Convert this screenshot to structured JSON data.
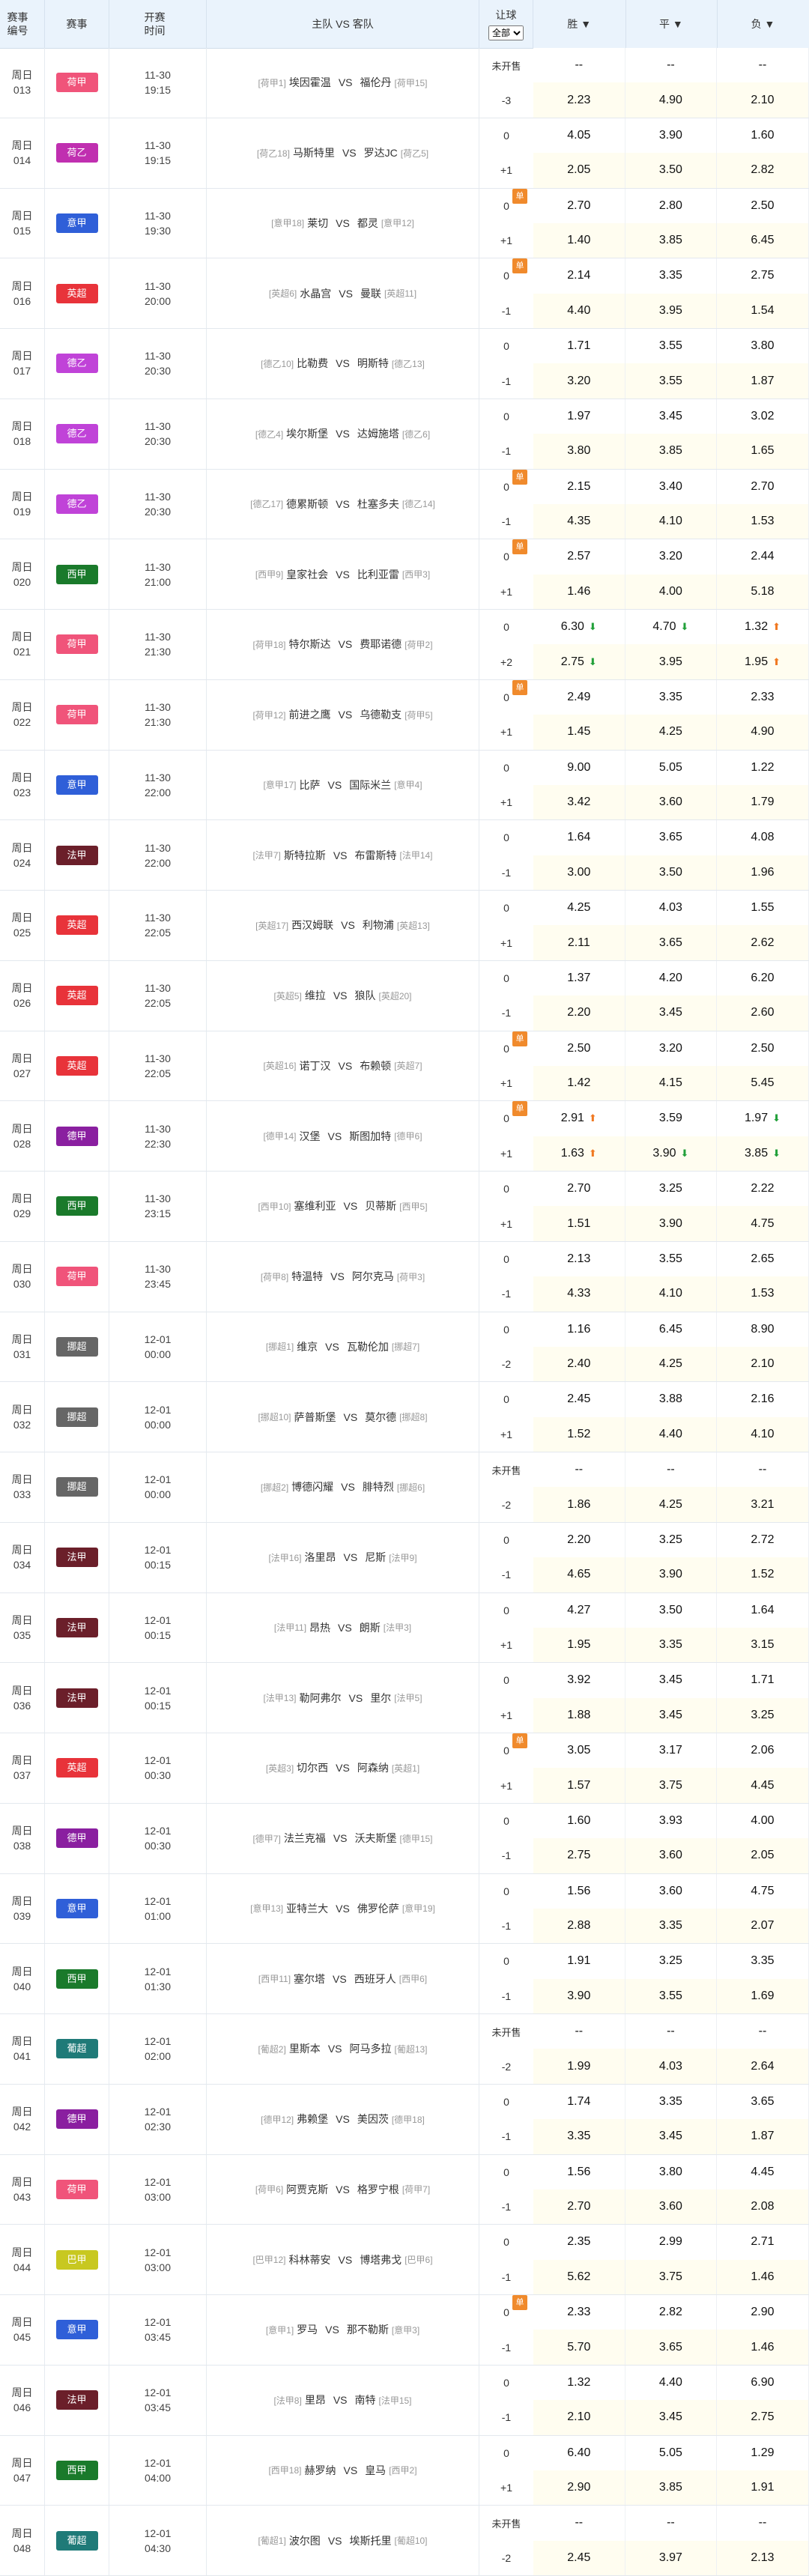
{
  "header": {
    "no": "赛事编号",
    "league": "赛事",
    "time": "开赛时间",
    "match": "主队 VS 客队",
    "rq": "让球",
    "filter": "全部",
    "win": "胜 ▼",
    "draw": "平 ▼",
    "lose": "负 ▼"
  },
  "colors": {
    "荷甲": "#f0547a",
    "荷乙": "#c02fb0",
    "意甲": "#2f5fd8",
    "英超": "#e8333a",
    "德乙": "#c043d8",
    "西甲": "#1a7a2b",
    "法甲": "#6b1f2a",
    "德甲": "#8a1fa0",
    "挪超": "#666666",
    "葡超": "#1f7a78",
    "巴甲": "#c8c820"
  },
  "rows": [
    {
      "no1": "周日",
      "no2": "013",
      "lg": "荷甲",
      "d": "11-30",
      "t": "19:15",
      "hr": "[荷甲1]",
      "h": "埃因霍温",
      "a": "福伦丹",
      "ar": "[荷甲15]",
      "r1": "未开售",
      "r2": "-3",
      "dan": false,
      "o1": [
        "--",
        "--",
        "--"
      ],
      "o2": [
        "2.23",
        "4.90",
        "2.10"
      ]
    },
    {
      "no1": "周日",
      "no2": "014",
      "lg": "荷乙",
      "d": "11-30",
      "t": "19:15",
      "hr": "[荷乙18]",
      "h": "马斯特里",
      "a": "罗达JC",
      "ar": "[荷乙5]",
      "r1": "0",
      "r2": "+1",
      "dan": false,
      "o1": [
        "4.05",
        "3.90",
        "1.60"
      ],
      "o2": [
        "2.05",
        "3.50",
        "2.82"
      ]
    },
    {
      "no1": "周日",
      "no2": "015",
      "lg": "意甲",
      "d": "11-30",
      "t": "19:30",
      "hr": "[意甲18]",
      "h": "莱切",
      "a": "都灵",
      "ar": "[意甲12]",
      "r1": "0",
      "r2": "+1",
      "dan": true,
      "o1": [
        "2.70",
        "2.80",
        "2.50"
      ],
      "o2": [
        "1.40",
        "3.85",
        "6.45"
      ]
    },
    {
      "no1": "周日",
      "no2": "016",
      "lg": "英超",
      "d": "11-30",
      "t": "20:00",
      "hr": "[英超6]",
      "h": "水晶宫",
      "a": "曼联",
      "ar": "[英超11]",
      "r1": "0",
      "r2": "-1",
      "dan": true,
      "o1": [
        "2.14",
        "3.35",
        "2.75"
      ],
      "o2": [
        "4.40",
        "3.95",
        "1.54"
      ]
    },
    {
      "no1": "周日",
      "no2": "017",
      "lg": "德乙",
      "d": "11-30",
      "t": "20:30",
      "hr": "[德乙10]",
      "h": "比勒费",
      "a": "明斯特",
      "ar": "[德乙13]",
      "r1": "0",
      "r2": "-1",
      "dan": false,
      "o1": [
        "1.71",
        "3.55",
        "3.80"
      ],
      "o2": [
        "3.20",
        "3.55",
        "1.87"
      ]
    },
    {
      "no1": "周日",
      "no2": "018",
      "lg": "德乙",
      "d": "11-30",
      "t": "20:30",
      "hr": "[德乙4]",
      "h": "埃尔斯堡",
      "a": "达姆施塔",
      "ar": "[德乙6]",
      "r1": "0",
      "r2": "-1",
      "dan": false,
      "o1": [
        "1.97",
        "3.45",
        "3.02"
      ],
      "o2": [
        "3.80",
        "3.85",
        "1.65"
      ]
    },
    {
      "no1": "周日",
      "no2": "019",
      "lg": "德乙",
      "d": "11-30",
      "t": "20:30",
      "hr": "[德乙17]",
      "h": "德累斯顿",
      "a": "杜塞多夫",
      "ar": "[德乙14]",
      "r1": "0",
      "r2": "-1",
      "dan": true,
      "o1": [
        "2.15",
        "3.40",
        "2.70"
      ],
      "o2": [
        "4.35",
        "4.10",
        "1.53"
      ]
    },
    {
      "no1": "周日",
      "no2": "020",
      "lg": "西甲",
      "d": "11-30",
      "t": "21:00",
      "hr": "[西甲9]",
      "h": "皇家社会",
      "a": "比利亚雷",
      "ar": "[西甲3]",
      "r1": "0",
      "r2": "+1",
      "dan": true,
      "o1": [
        "2.57",
        "3.20",
        "2.44"
      ],
      "o2": [
        "1.46",
        "4.00",
        "5.18"
      ]
    },
    {
      "no1": "周日",
      "no2": "021",
      "lg": "荷甲",
      "d": "11-30",
      "t": "21:30",
      "hr": "[荷甲18]",
      "h": "特尔斯达",
      "a": "费耶诺德",
      "ar": "[荷甲2]",
      "r1": "0",
      "r2": "+2",
      "dan": false,
      "o1": [
        "6.30",
        "4.70",
        "1.32"
      ],
      "o2": [
        "2.75",
        "3.95",
        "1.95"
      ],
      "a1": [
        "down",
        "down",
        "up"
      ],
      "a2": [
        "down",
        "",
        "up"
      ]
    },
    {
      "no1": "周日",
      "no2": "022",
      "lg": "荷甲",
      "d": "11-30",
      "t": "21:30",
      "hr": "[荷甲12]",
      "h": "前进之鹰",
      "a": "乌德勒支",
      "ar": "[荷甲5]",
      "r1": "0",
      "r2": "+1",
      "dan": true,
      "o1": [
        "2.49",
        "3.35",
        "2.33"
      ],
      "o2": [
        "1.45",
        "4.25",
        "4.90"
      ]
    },
    {
      "no1": "周日",
      "no2": "023",
      "lg": "意甲",
      "d": "11-30",
      "t": "22:00",
      "hr": "[意甲17]",
      "h": "比萨",
      "a": "国际米兰",
      "ar": "[意甲4]",
      "r1": "0",
      "r2": "+1",
      "dan": false,
      "o1": [
        "9.00",
        "5.05",
        "1.22"
      ],
      "o2": [
        "3.42",
        "3.60",
        "1.79"
      ]
    },
    {
      "no1": "周日",
      "no2": "024",
      "lg": "法甲",
      "d": "11-30",
      "t": "22:00",
      "hr": "[法甲7]",
      "h": "斯特拉斯",
      "a": "布雷斯特",
      "ar": "[法甲14]",
      "r1": "0",
      "r2": "-1",
      "dan": false,
      "o1": [
        "1.64",
        "3.65",
        "4.08"
      ],
      "o2": [
        "3.00",
        "3.50",
        "1.96"
      ]
    },
    {
      "no1": "周日",
      "no2": "025",
      "lg": "英超",
      "d": "11-30",
      "t": "22:05",
      "hr": "[英超17]",
      "h": "西汉姆联",
      "a": "利物浦",
      "ar": "[英超13]",
      "r1": "0",
      "r2": "+1",
      "dan": false,
      "o1": [
        "4.25",
        "4.03",
        "1.55"
      ],
      "o2": [
        "2.11",
        "3.65",
        "2.62"
      ]
    },
    {
      "no1": "周日",
      "no2": "026",
      "lg": "英超",
      "d": "11-30",
      "t": "22:05",
      "hr": "[英超5]",
      "h": "维拉",
      "a": "狼队",
      "ar": "[英超20]",
      "r1": "0",
      "r2": "-1",
      "dan": false,
      "o1": [
        "1.37",
        "4.20",
        "6.20"
      ],
      "o2": [
        "2.20",
        "3.45",
        "2.60"
      ]
    },
    {
      "no1": "周日",
      "no2": "027",
      "lg": "英超",
      "d": "11-30",
      "t": "22:05",
      "hr": "[英超16]",
      "h": "诺丁汉",
      "a": "布赖顿",
      "ar": "[英超7]",
      "r1": "0",
      "r2": "+1",
      "dan": true,
      "o1": [
        "2.50",
        "3.20",
        "2.50"
      ],
      "o2": [
        "1.42",
        "4.15",
        "5.45"
      ]
    },
    {
      "no1": "周日",
      "no2": "028",
      "lg": "德甲",
      "d": "11-30",
      "t": "22:30",
      "hr": "[德甲14]",
      "h": "汉堡",
      "a": "斯图加特",
      "ar": "[德甲6]",
      "r1": "0",
      "r2": "+1",
      "dan": true,
      "o1": [
        "2.91",
        "3.59",
        "1.97"
      ],
      "o2": [
        "1.63",
        "3.90",
        "3.85"
      ],
      "a1": [
        "up",
        "",
        "down"
      ],
      "a2": [
        "up",
        "down",
        "down"
      ]
    },
    {
      "no1": "周日",
      "no2": "029",
      "lg": "西甲",
      "d": "11-30",
      "t": "23:15",
      "hr": "[西甲10]",
      "h": "塞维利亚",
      "a": "贝蒂斯",
      "ar": "[西甲5]",
      "r1": "0",
      "r2": "+1",
      "dan": false,
      "o1": [
        "2.70",
        "3.25",
        "2.22"
      ],
      "o2": [
        "1.51",
        "3.90",
        "4.75"
      ]
    },
    {
      "no1": "周日",
      "no2": "030",
      "lg": "荷甲",
      "d": "11-30",
      "t": "23:45",
      "hr": "[荷甲8]",
      "h": "特温特",
      "a": "阿尔克马",
      "ar": "[荷甲3]",
      "r1": "0",
      "r2": "-1",
      "dan": false,
      "o1": [
        "2.13",
        "3.55",
        "2.65"
      ],
      "o2": [
        "4.33",
        "4.10",
        "1.53"
      ]
    },
    {
      "no1": "周日",
      "no2": "031",
      "lg": "挪超",
      "d": "12-01",
      "t": "00:00",
      "hr": "[挪超1]",
      "h": "维京",
      "a": "瓦勒伦加",
      "ar": "[挪超7]",
      "r1": "0",
      "r2": "-2",
      "dan": false,
      "o1": [
        "1.16",
        "6.45",
        "8.90"
      ],
      "o2": [
        "2.40",
        "4.25",
        "2.10"
      ]
    },
    {
      "no1": "周日",
      "no2": "032",
      "lg": "挪超",
      "d": "12-01",
      "t": "00:00",
      "hr": "[挪超10]",
      "h": "萨普斯堡",
      "a": "莫尔德",
      "ar": "[挪超8]",
      "r1": "0",
      "r2": "+1",
      "dan": false,
      "o1": [
        "2.45",
        "3.88",
        "2.16"
      ],
      "o2": [
        "1.52",
        "4.40",
        "4.10"
      ]
    },
    {
      "no1": "周日",
      "no2": "033",
      "lg": "挪超",
      "d": "12-01",
      "t": "00:00",
      "hr": "[挪超2]",
      "h": "博德闪耀",
      "a": "腓特烈",
      "ar": "[挪超6]",
      "r1": "未开售",
      "r2": "-2",
      "dan": false,
      "o1": [
        "--",
        "--",
        "--"
      ],
      "o2": [
        "1.86",
        "4.25",
        "3.21"
      ]
    },
    {
      "no1": "周日",
      "no2": "034",
      "lg": "法甲",
      "d": "12-01",
      "t": "00:15",
      "hr": "[法甲16]",
      "h": "洛里昂",
      "a": "尼斯",
      "ar": "[法甲9]",
      "r1": "0",
      "r2": "-1",
      "dan": false,
      "o1": [
        "2.20",
        "3.25",
        "2.72"
      ],
      "o2": [
        "4.65",
        "3.90",
        "1.52"
      ]
    },
    {
      "no1": "周日",
      "no2": "035",
      "lg": "法甲",
      "d": "12-01",
      "t": "00:15",
      "hr": "[法甲11]",
      "h": "昂热",
      "a": "朗斯",
      "ar": "[法甲3]",
      "r1": "0",
      "r2": "+1",
      "dan": false,
      "o1": [
        "4.27",
        "3.50",
        "1.64"
      ],
      "o2": [
        "1.95",
        "3.35",
        "3.15"
      ]
    },
    {
      "no1": "周日",
      "no2": "036",
      "lg": "法甲",
      "d": "12-01",
      "t": "00:15",
      "hr": "[法甲13]",
      "h": "勒阿弗尔",
      "a": "里尔",
      "ar": "[法甲5]",
      "r1": "0",
      "r2": "+1",
      "dan": false,
      "o1": [
        "3.92",
        "3.45",
        "1.71"
      ],
      "o2": [
        "1.88",
        "3.45",
        "3.25"
      ]
    },
    {
      "no1": "周日",
      "no2": "037",
      "lg": "英超",
      "d": "12-01",
      "t": "00:30",
      "hr": "[英超3]",
      "h": "切尔西",
      "a": "阿森纳",
      "ar": "[英超1]",
      "r1": "0",
      "r2": "+1",
      "dan": true,
      "o1": [
        "3.05",
        "3.17",
        "2.06"
      ],
      "o2": [
        "1.57",
        "3.75",
        "4.45"
      ]
    },
    {
      "no1": "周日",
      "no2": "038",
      "lg": "德甲",
      "d": "12-01",
      "t": "00:30",
      "hr": "[德甲7]",
      "h": "法兰克福",
      "a": "沃夫斯堡",
      "ar": "[德甲15]",
      "r1": "0",
      "r2": "-1",
      "dan": false,
      "o1": [
        "1.60",
        "3.93",
        "4.00"
      ],
      "o2": [
        "2.75",
        "3.60",
        "2.05"
      ]
    },
    {
      "no1": "周日",
      "no2": "039",
      "lg": "意甲",
      "d": "12-01",
      "t": "01:00",
      "hr": "[意甲13]",
      "h": "亚特兰大",
      "a": "佛罗伦萨",
      "ar": "[意甲19]",
      "r1": "0",
      "r2": "-1",
      "dan": false,
      "o1": [
        "1.56",
        "3.60",
        "4.75"
      ],
      "o2": [
        "2.88",
        "3.35",
        "2.07"
      ]
    },
    {
      "no1": "周日",
      "no2": "040",
      "lg": "西甲",
      "d": "12-01",
      "t": "01:30",
      "hr": "[西甲11]",
      "h": "塞尔塔",
      "a": "西班牙人",
      "ar": "[西甲6]",
      "r1": "0",
      "r2": "-1",
      "dan": false,
      "o1": [
        "1.91",
        "3.25",
        "3.35"
      ],
      "o2": [
        "3.90",
        "3.55",
        "1.69"
      ]
    },
    {
      "no1": "周日",
      "no2": "041",
      "lg": "葡超",
      "d": "12-01",
      "t": "02:00",
      "hr": "[葡超2]",
      "h": "里斯本",
      "a": "阿马多拉",
      "ar": "[葡超13]",
      "r1": "未开售",
      "r2": "-2",
      "dan": false,
      "o1": [
        "--",
        "--",
        "--"
      ],
      "o2": [
        "1.99",
        "4.03",
        "2.64"
      ]
    },
    {
      "no1": "周日",
      "no2": "042",
      "lg": "德甲",
      "d": "12-01",
      "t": "02:30",
      "hr": "[德甲12]",
      "h": "弗赖堡",
      "a": "美因茨",
      "ar": "[德甲18]",
      "r1": "0",
      "r2": "-1",
      "dan": false,
      "o1": [
        "1.74",
        "3.35",
        "3.65"
      ],
      "o2": [
        "3.35",
        "3.45",
        "1.87"
      ]
    },
    {
      "no1": "周日",
      "no2": "043",
      "lg": "荷甲",
      "d": "12-01",
      "t": "03:00",
      "hr": "[荷甲6]",
      "h": "阿贾克斯",
      "a": "格罗宁根",
      "ar": "[荷甲7]",
      "r1": "0",
      "r2": "-1",
      "dan": false,
      "o1": [
        "1.56",
        "3.80",
        "4.45"
      ],
      "o2": [
        "2.70",
        "3.60",
        "2.08"
      ]
    },
    {
      "no1": "周日",
      "no2": "044",
      "lg": "巴甲",
      "d": "12-01",
      "t": "03:00",
      "hr": "[巴甲12]",
      "h": "科林蒂安",
      "a": "博塔弗戈",
      "ar": "[巴甲6]",
      "r1": "0",
      "r2": "-1",
      "dan": false,
      "o1": [
        "2.35",
        "2.99",
        "2.71"
      ],
      "o2": [
        "5.62",
        "3.75",
        "1.46"
      ]
    },
    {
      "no1": "周日",
      "no2": "045",
      "lg": "意甲",
      "d": "12-01",
      "t": "03:45",
      "hr": "[意甲1]",
      "h": "罗马",
      "a": "那不勒斯",
      "ar": "[意甲3]",
      "r1": "0",
      "r2": "-1",
      "dan": true,
      "o1": [
        "2.33",
        "2.82",
        "2.90"
      ],
      "o2": [
        "5.70",
        "3.65",
        "1.46"
      ]
    },
    {
      "no1": "周日",
      "no2": "046",
      "lg": "法甲",
      "d": "12-01",
      "t": "03:45",
      "hr": "[法甲8]",
      "h": "里昂",
      "a": "南特",
      "ar": "[法甲15]",
      "r1": "0",
      "r2": "-1",
      "dan": false,
      "o1": [
        "1.32",
        "4.40",
        "6.90"
      ],
      "o2": [
        "2.10",
        "3.45",
        "2.75"
      ]
    },
    {
      "no1": "周日",
      "no2": "047",
      "lg": "西甲",
      "d": "12-01",
      "t": "04:00",
      "hr": "[西甲18]",
      "h": "赫罗纳",
      "a": "皇马",
      "ar": "[西甲2]",
      "r1": "0",
      "r2": "+1",
      "dan": false,
      "o1": [
        "6.40",
        "5.05",
        "1.29"
      ],
      "o2": [
        "2.90",
        "3.85",
        "1.91"
      ]
    },
    {
      "no1": "周日",
      "no2": "048",
      "lg": "葡超",
      "d": "12-01",
      "t": "04:30",
      "hr": "[葡超1]",
      "h": "波尔图",
      "a": "埃斯托里",
      "ar": "[葡超10]",
      "r1": "未开售",
      "r2": "-2",
      "dan": false,
      "o1": [
        "--",
        "--",
        "--"
      ],
      "o2": [
        "2.45",
        "3.97",
        "2.13"
      ]
    }
  ]
}
